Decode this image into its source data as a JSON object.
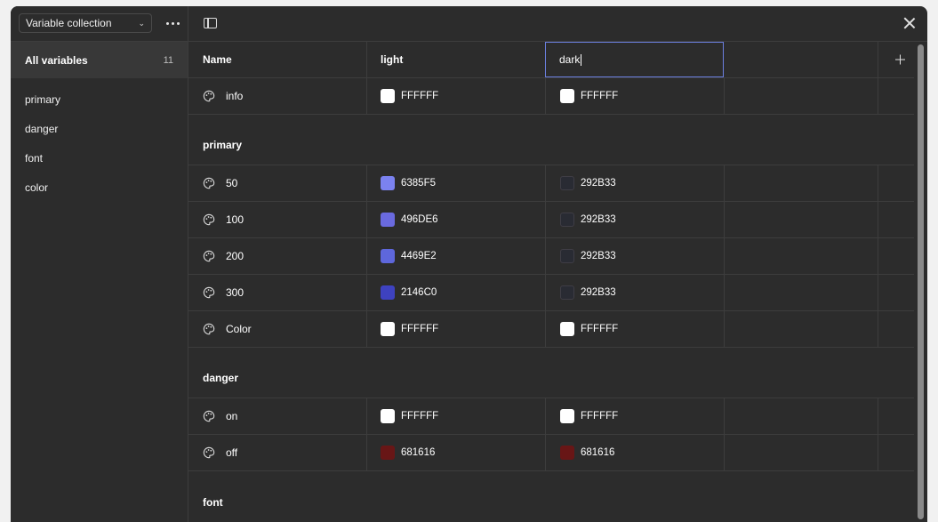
{
  "sidebar": {
    "collection_label": "Variable collection",
    "all_variables": {
      "label": "All variables",
      "count": "11"
    },
    "groups": [
      "primary",
      "danger",
      "font",
      "color"
    ]
  },
  "table": {
    "headers": {
      "name": "Name",
      "light": "light",
      "dark": "dark"
    },
    "ungrouped": [
      {
        "name": "info",
        "light": "FFFFFF",
        "dark": "FFFFFF",
        "light_color": "#FFFFFF",
        "dark_color": "#FFFFFF"
      }
    ],
    "groups": [
      {
        "title": "primary",
        "rows": [
          {
            "name": "50",
            "light": "6385F5",
            "dark": "292B33",
            "light_color": "#7B82F0",
            "dark_color": "#292B33"
          },
          {
            "name": "100",
            "light": "496DE6",
            "dark": "292B33",
            "light_color": "#6A6ADF",
            "dark_color": "#292B33"
          },
          {
            "name": "200",
            "light": "4469E2",
            "dark": "292B33",
            "light_color": "#5E67DC",
            "dark_color": "#292B33"
          },
          {
            "name": "300",
            "light": "2146C0",
            "dark": "292B33",
            "light_color": "#3E42C0",
            "dark_color": "#292B33"
          },
          {
            "name": "Color",
            "light": "FFFFFF",
            "dark": "FFFFFF",
            "light_color": "#FFFFFF",
            "dark_color": "#FFFFFF"
          }
        ]
      },
      {
        "title": "danger",
        "rows": [
          {
            "name": "on",
            "light": "FFFFFF",
            "dark": "FFFFFF",
            "light_color": "#FFFFFF",
            "dark_color": "#FFFFFF"
          },
          {
            "name": "off",
            "light": "681616",
            "dark": "681616",
            "light_color": "#681616",
            "dark_color": "#681616"
          }
        ]
      },
      {
        "title": "font",
        "rows": []
      }
    ]
  },
  "icons": {
    "row_icon": "palette-icon",
    "panel": "sidebar-toggle-icon",
    "close": "close-icon",
    "add": "plus-icon",
    "more": "more-icon",
    "dropdown": "chevron-down-icon"
  }
}
